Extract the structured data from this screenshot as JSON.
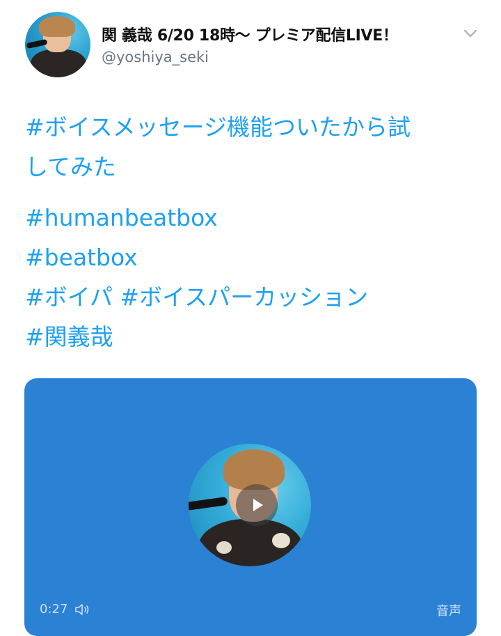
{
  "author": {
    "display_name": "関 義哉 6/20 18時〜 プレミア配信LIVE！",
    "handle": "@yoshiya_seki"
  },
  "tweet": {
    "line1": "#ボイスメッセージ機能ついたから試",
    "line2": "してみた",
    "line3": "#humanbeatbox",
    "line4": "#beatbox",
    "line5": "#ボイパ #ボイスパーカッション",
    "line6": "#関義哉"
  },
  "voice_card": {
    "duration": "0:27",
    "label": "音声",
    "background": "#2b81d3"
  },
  "colors": {
    "link": "#1da1f2",
    "handle": "#657786"
  },
  "icons": [
    "chevron-down-icon",
    "play-icon",
    "speaker-icon"
  ]
}
